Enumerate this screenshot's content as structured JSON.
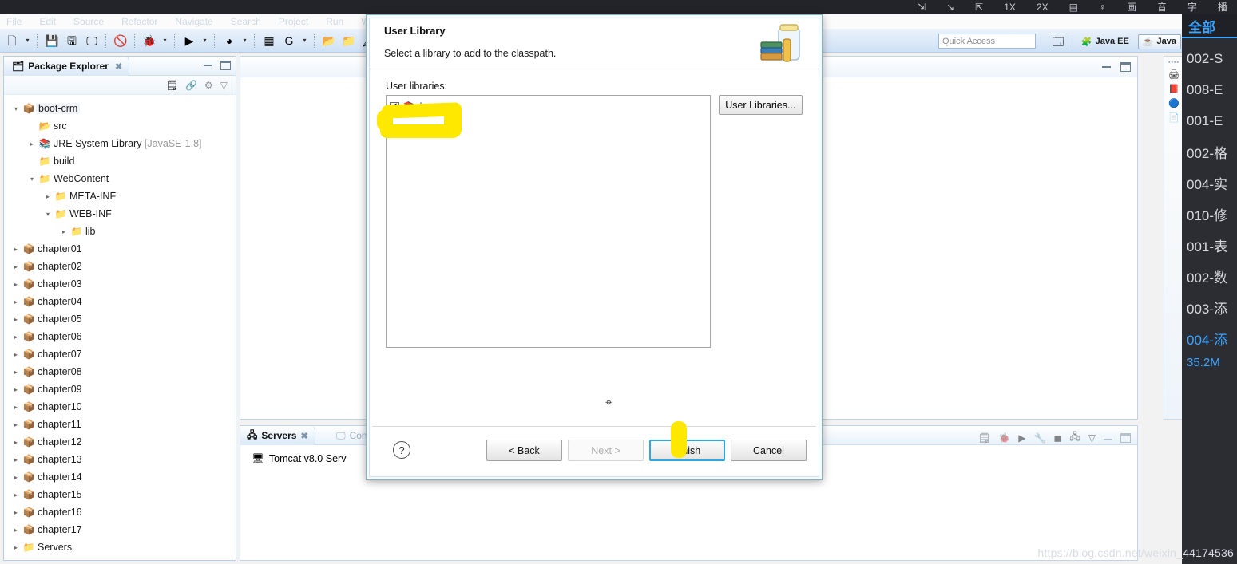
{
  "player": {
    "tools": [
      {
        "name": "pin-icon",
        "glyph": "⇲"
      },
      {
        "name": "pointer-icon",
        "glyph": "↘"
      },
      {
        "name": "screenshot-icon",
        "glyph": "⇱"
      },
      {
        "name": "speed-1x",
        "glyph": "1X"
      },
      {
        "name": "speed-2x",
        "glyph": "2X"
      },
      {
        "name": "split-screen-icon",
        "glyph": "▤"
      },
      {
        "name": "bulb-icon",
        "glyph": "♀"
      },
      {
        "name": "picture-label",
        "glyph": "画"
      },
      {
        "name": "audio-label",
        "glyph": "音"
      },
      {
        "name": "subtitle-label",
        "glyph": "字"
      },
      {
        "name": "playlist-label",
        "glyph": "播"
      }
    ],
    "panel_title": "全部",
    "episodes": [
      "002-S",
      "008-E",
      "001-E",
      "002-格",
      "004-实",
      "010-修",
      "001-表",
      "002-数",
      "003-添",
      "004-添"
    ],
    "active_episode_index": 9,
    "size_label": "35.2M",
    "accent_color": "#3da4ff"
  },
  "eclipse": {
    "menu": [
      "File",
      "Edit",
      "Source",
      "Refactor",
      "Navigate",
      "Search",
      "Project",
      "Run",
      "Win"
    ],
    "toolbar_icons": [
      {
        "name": "new-wizard-icon",
        "glyph": "🗋"
      },
      {
        "name": "new-dropdown-arrow",
        "glyph": "▾"
      },
      {
        "name": "save-icon",
        "glyph": "💾"
      },
      {
        "name": "save-all-icon",
        "glyph": "🖫"
      },
      {
        "name": "toggle-console-icon",
        "glyph": "🖵"
      },
      {
        "name": "skip-breakpoints-icon",
        "glyph": "🚫"
      },
      {
        "name": "debug-icon",
        "glyph": "🐞"
      },
      {
        "name": "debug-dropdown-arrow",
        "glyph": "▾"
      },
      {
        "name": "run-icon",
        "glyph": "▶"
      },
      {
        "name": "run-dropdown-arrow",
        "glyph": "▾"
      },
      {
        "name": "run-as-server-icon",
        "glyph": "◕"
      },
      {
        "name": "server-dropdown-arrow",
        "glyph": "▾"
      },
      {
        "name": "new-java-package-icon",
        "glyph": "▦"
      },
      {
        "name": "external-tools-icon",
        "glyph": "G"
      },
      {
        "name": "external-dropdown-arrow",
        "glyph": "▾"
      },
      {
        "name": "new-class-icon",
        "glyph": "📂"
      },
      {
        "name": "open-type-icon",
        "glyph": "📁"
      },
      {
        "name": "search-icon",
        "glyph": "🖊"
      }
    ],
    "quick_access_placeholder": "Quick Access",
    "perspective": {
      "open_perspective_icon": "open-perspective-icon",
      "items": [
        {
          "label": "Java EE",
          "selected": false,
          "icon": "java-ee-perspective-icon"
        },
        {
          "label": "Java",
          "selected": true,
          "icon": "java-perspective-icon"
        }
      ]
    },
    "package_explorer": {
      "tab_label": "Package Explorer",
      "view_icons": [
        "collapse-all-icon",
        "link-with-editor-icon",
        "view-menu-icon",
        "filter-icon"
      ],
      "tree": [
        {
          "label": "boot-crm",
          "indent": 0,
          "twisty": "▾",
          "icon": "java-project-icon",
          "selected": true
        },
        {
          "label": "src",
          "indent": 1,
          "twisty": "",
          "icon": "source-folder-icon"
        },
        {
          "label": "JRE System Library",
          "suffix": " [JavaSE-1.8]",
          "indent": 1,
          "twisty": "▸",
          "icon": "library-icon"
        },
        {
          "label": "build",
          "indent": 1,
          "twisty": "",
          "icon": "folder-icon"
        },
        {
          "label": "WebContent",
          "indent": 1,
          "twisty": "▾",
          "icon": "folder-icon"
        },
        {
          "label": "META-INF",
          "indent": 2,
          "twisty": "▸",
          "icon": "folder-icon"
        },
        {
          "label": "WEB-INF",
          "indent": 2,
          "twisty": "▾",
          "icon": "folder-icon"
        },
        {
          "label": "lib",
          "indent": 3,
          "twisty": "▸",
          "icon": "folder-icon"
        },
        {
          "label": "chapter01",
          "indent": 0,
          "twisty": "▸",
          "icon": "java-project-icon"
        },
        {
          "label": "chapter02",
          "indent": 0,
          "twisty": "▸",
          "icon": "java-project-icon"
        },
        {
          "label": "chapter03",
          "indent": 0,
          "twisty": "▸",
          "icon": "java-project-icon"
        },
        {
          "label": "chapter04",
          "indent": 0,
          "twisty": "▸",
          "icon": "java-project-icon"
        },
        {
          "label": "chapter05",
          "indent": 0,
          "twisty": "▸",
          "icon": "java-project-icon"
        },
        {
          "label": "chapter06",
          "indent": 0,
          "twisty": "▸",
          "icon": "java-project-icon"
        },
        {
          "label": "chapter07",
          "indent": 0,
          "twisty": "▸",
          "icon": "java-project-icon"
        },
        {
          "label": "chapter08",
          "indent": 0,
          "twisty": "▸",
          "icon": "java-project-icon"
        },
        {
          "label": "chapter09",
          "indent": 0,
          "twisty": "▸",
          "icon": "java-project-icon"
        },
        {
          "label": "chapter10",
          "indent": 0,
          "twisty": "▸",
          "icon": "java-project-icon"
        },
        {
          "label": "chapter11",
          "indent": 0,
          "twisty": "▸",
          "icon": "java-project-icon"
        },
        {
          "label": "chapter12",
          "indent": 0,
          "twisty": "▸",
          "icon": "java-project-icon"
        },
        {
          "label": "chapter13",
          "indent": 0,
          "twisty": "▸",
          "icon": "java-project-icon"
        },
        {
          "label": "chapter14",
          "indent": 0,
          "twisty": "▸",
          "icon": "java-project-icon"
        },
        {
          "label": "chapter15",
          "indent": 0,
          "twisty": "▸",
          "icon": "java-project-icon"
        },
        {
          "label": "chapter16",
          "indent": 0,
          "twisty": "▸",
          "icon": "java-project-locked-icon"
        },
        {
          "label": "chapter17",
          "indent": 0,
          "twisty": "▸",
          "icon": "java-project-icon"
        },
        {
          "label": "Servers",
          "indent": 0,
          "twisty": "▸",
          "icon": "folder-icon"
        }
      ]
    },
    "servers_view": {
      "tabs": [
        {
          "label": "Servers",
          "active": true,
          "icon": "servers-icon"
        },
        {
          "label": "Cons",
          "active": false,
          "icon": "console-icon"
        }
      ],
      "toolbar_icons": [
        "new-server-icon",
        "debug-server-icon",
        "start-server-icon",
        "profile-server-icon",
        "stop-server-icon",
        "publish-icon",
        "view-menu-icon",
        "minimize-icon",
        "maximize-icon"
      ],
      "rows": [
        {
          "label": "Tomcat v8.0 Serv",
          "icon": "tomcat-server-icon"
        }
      ]
    },
    "fast_view_icons": [
      "fastview-dots",
      "printer-icon",
      "bookmark-icon",
      "at-icon",
      "document-icon"
    ]
  },
  "dialog": {
    "title": "User Library",
    "subtitle": "Select a library to add to the classpath.",
    "header_icon": "jar-library-icon",
    "list_label": "User libraries:",
    "libraries": [
      {
        "label": "jsp",
        "checked": true,
        "icon": "library-icon"
      }
    ],
    "side_buttons": [
      {
        "label": "User Libraries...",
        "name": "user-libraries-button"
      }
    ],
    "help_glyph": "?",
    "buttons": [
      {
        "label": "< Back",
        "state": "enabled",
        "name": "back-button"
      },
      {
        "label": "Next >",
        "state": "disabled",
        "name": "next-button"
      },
      {
        "label": "Finish",
        "state": "default",
        "name": "finish-button"
      },
      {
        "label": "Cancel",
        "state": "enabled",
        "name": "cancel-button"
      }
    ]
  },
  "annotations": {
    "highlight_color": "#ffe800",
    "watermark": "https://blog.csdn.net/weixin_44174536"
  }
}
